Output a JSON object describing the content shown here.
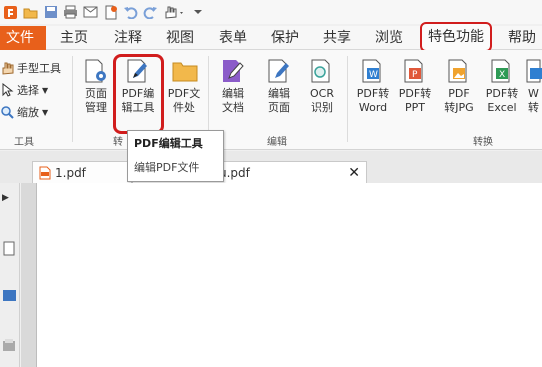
{
  "menu": {
    "file": "文件",
    "items": [
      "主页",
      "注释",
      "视图",
      "表单",
      "保护",
      "共享",
      "浏览"
    ],
    "special": "特色功能",
    "help": "帮助"
  },
  "ribbon": {
    "tools_group": {
      "hand": "手型工具",
      "select": "选择",
      "zoom": "缩放",
      "label": "工具"
    },
    "buttons": {
      "page_manage": "页面\n管理",
      "pdf_edit_tool": "PDF编\n辑工具",
      "pdf_file": "PDF文\n件处",
      "edit_doc": "编辑\n文档",
      "edit_page": "编辑\n页面",
      "ocr": "OCR\n识别",
      "pdf_word": "PDF转\nWord",
      "pdf_ppt": "PDF转\nPPT",
      "pdf_jpg": "PDF\n转JPG",
      "pdf_excel": "PDF转\nExcel",
      "more": "W\n转"
    },
    "group_labels": {
      "first": "转",
      "edit": "编辑",
      "convert": "转换"
    }
  },
  "tooltip": {
    "title": "PDF编辑工具",
    "desc": "编辑PDF文件"
  },
  "tabs": [
    {
      "label": "1.pdf"
    },
    {
      "label": "u.pdf"
    }
  ],
  "colors": {
    "accent": "#e8601b",
    "highlight": "#d11d1d"
  }
}
